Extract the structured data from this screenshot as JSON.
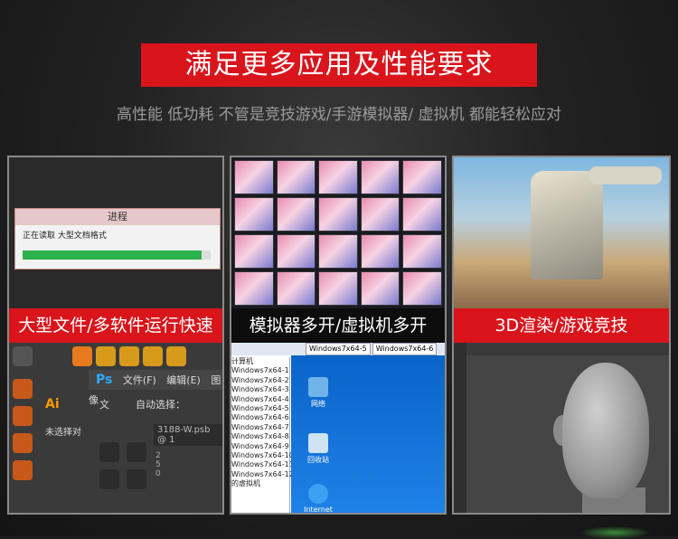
{
  "header": {
    "banner_text": "满足更多应用及性能要求",
    "subtitle": "高性能  低功耗 不管是竞技游戏/手游模拟器/ 虚拟机 都能轻松应对"
  },
  "colors": {
    "accent_red": "#d9141b",
    "ribbon_black": "#0d0d0d",
    "progress_green": "#2bb24c"
  },
  "panels": [
    {
      "ribbon": "大型文件/多软件运行快速",
      "dialog": {
        "title": "进程",
        "text": "正在读取 大型文档格式",
        "progress": 0.95
      },
      "app": {
        "ps_label": "Ps",
        "ps_menu": [
          "文件(F)",
          "编辑(E)",
          "图像"
        ],
        "ai_label": "Ai",
        "ai_menu": "文",
        "auto_select": "自动选择：",
        "no_selection": "未选择对",
        "doc_name": "3188-W.psb @ 1",
        "ruler_marks": [
          "2",
          "5",
          "0"
        ]
      }
    },
    {
      "ribbon": "模拟器多开/虚拟机多开",
      "vm": {
        "tabs": [
          "Windows7x64-5",
          "Windows7x64-6"
        ],
        "list_header": "计算机",
        "list": [
          "Windows7x64-1",
          "Windows7x64-2",
          "Windows7x64-3",
          "Windows7x64-4",
          "Windows7x64-5",
          "Windows7x64-6",
          "Windows7x64-7",
          "Windows7x64-8",
          "Windows7x64-9",
          "Windows7x64-10",
          "Windows7x64-11",
          "Windows7x64-12"
        ],
        "list_footer": "的虚拟机",
        "desktop_icons": [
          "网络",
          "回收站",
          "Internet Explorer"
        ]
      }
    },
    {
      "ribbon": "3D渲染/游戏竞技"
    }
  ]
}
